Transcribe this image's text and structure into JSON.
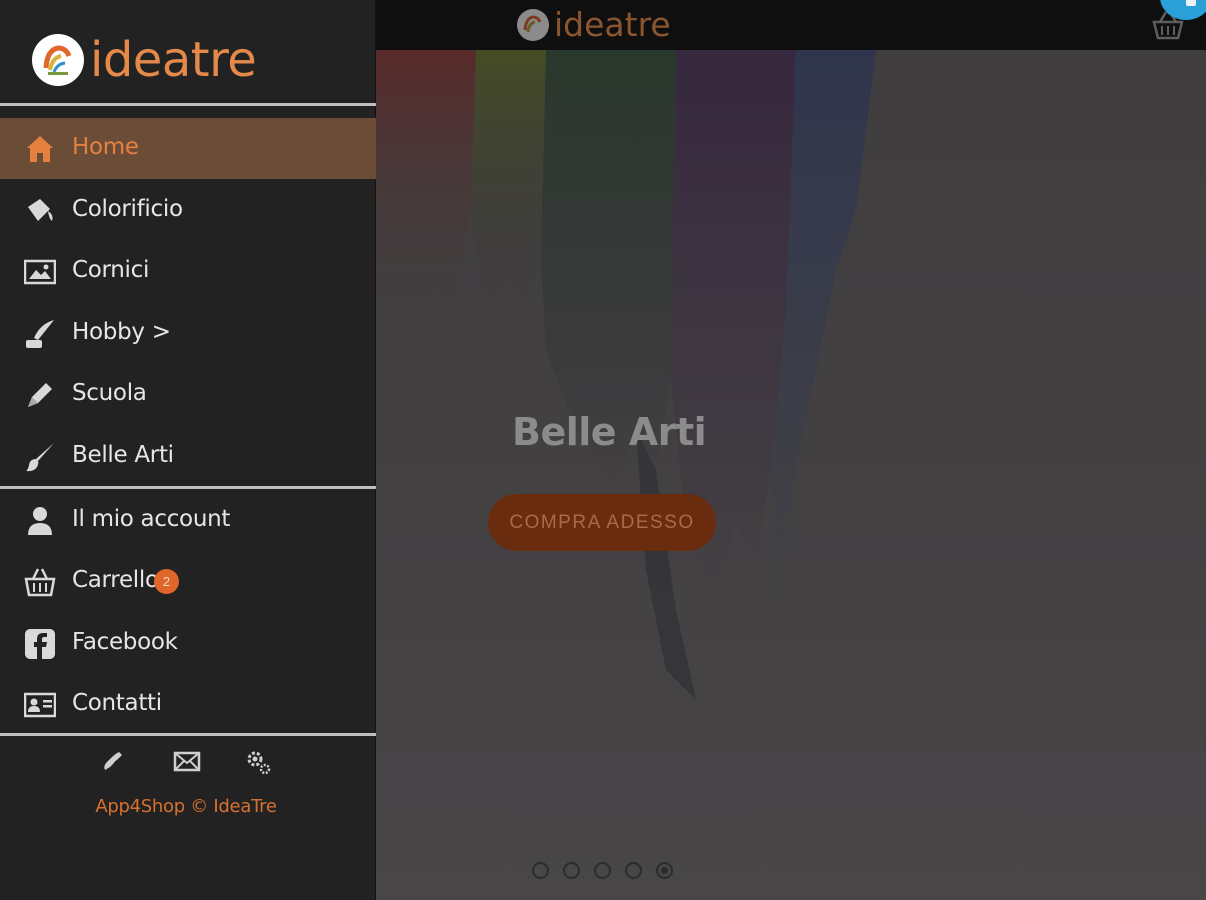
{
  "brand": {
    "name": "ideatre",
    "accent_color": "#e5813f"
  },
  "topbar": {
    "logo_text": "ideatre",
    "cart_icon": "basket-icon"
  },
  "hero": {
    "title": "Belle Arti",
    "cta_label": "COMPRA ADESSO",
    "slides_total": 5,
    "active_slide": 5
  },
  "sidebar": {
    "logo_text": "ideatre",
    "items": [
      {
        "label": "Home",
        "icon": "home-icon",
        "active": true
      },
      {
        "label": "Colorificio",
        "icon": "paint-bucket-icon"
      },
      {
        "label": "Cornici",
        "icon": "picture-frame-icon"
      },
      {
        "label": "Hobby >",
        "icon": "quill-icon"
      },
      {
        "label": "Scuola",
        "icon": "pencil-icon"
      },
      {
        "label": "Belle Arti",
        "icon": "paintbrush-icon"
      }
    ],
    "account_items": [
      {
        "label": "Il mio account",
        "icon": "user-icon"
      },
      {
        "label": "Carrello",
        "icon": "basket-icon",
        "badge": "2"
      },
      {
        "label": "Facebook",
        "icon": "facebook-icon"
      },
      {
        "label": "Contatti",
        "icon": "contact-card-icon"
      }
    ],
    "footer": {
      "icons": [
        "phone-icon",
        "mail-icon",
        "settings-icon"
      ],
      "copyright": "App4Shop © IdeaTre"
    }
  }
}
